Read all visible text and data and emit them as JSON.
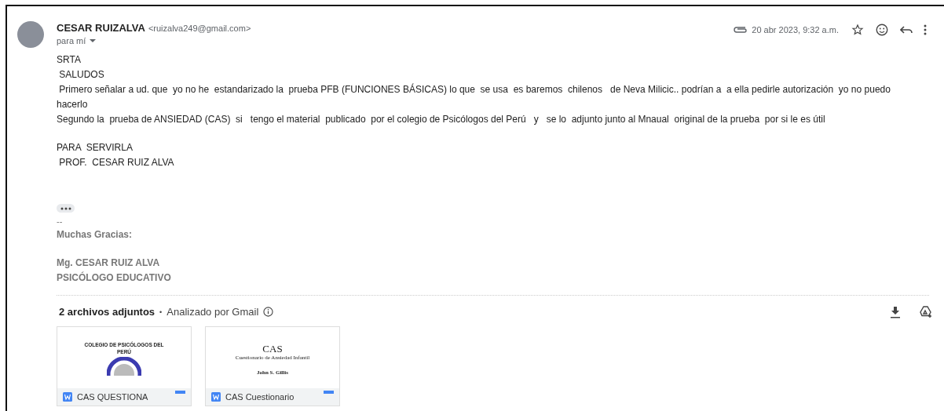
{
  "sender": {
    "name": "CESAR RUIZALVA",
    "email": "<ruizalva249@gmail.com>",
    "recipient": "para mí"
  },
  "header": {
    "date": "20 abr 2023, 9:32 a.m.",
    "starred": false
  },
  "body": {
    "paragraphs": [
      [
        "SRTA",
        " SALUDOS",
        " Primero señalar a ud. que  yo no he  estandarizado la  prueba PFB (FUNCIONES BÁSICAS) lo que  se usa  es baremos  chilenos   de Neva Milicic.. podrían a  a ella pedirle autorización  yo no puedo hacerlo",
        "Segundo la  prueba de ANSIEDAD (CAS)  si   tengo el material  publicado  por el colegio de Psicólogos del Perú   y   se lo  adjunto junto al Mnaual  original de la prueba  por si le es útil"
      ],
      [
        "PARA  SERVIRLA",
        " PROF.  CESAR RUIZ ALVA"
      ]
    ]
  },
  "signature": {
    "separator": "--",
    "paragraphs": [
      [
        "Muchas Gracias:"
      ],
      [
        "Mg. CESAR RUIZ ALVA",
        "PSICÓLOGO EDUCATIVO"
      ]
    ]
  },
  "attachments": {
    "title": "2 archivos adjuntos",
    "separator": "•",
    "scan_note": "Analizado por Gmail",
    "files": [
      {
        "kind": "seal",
        "preview_lines": [
          "COLEGIO DE PSICÓLOGOS DEL",
          "PERÚ"
        ],
        "name": "CAS QUESTIONA"
      },
      {
        "kind": "title",
        "preview_lines": [
          "CAS",
          "Cuestionario de Ansiedad Infantil",
          "John S. Gillis"
        ],
        "name": "CAS Cuestionario"
      }
    ]
  }
}
